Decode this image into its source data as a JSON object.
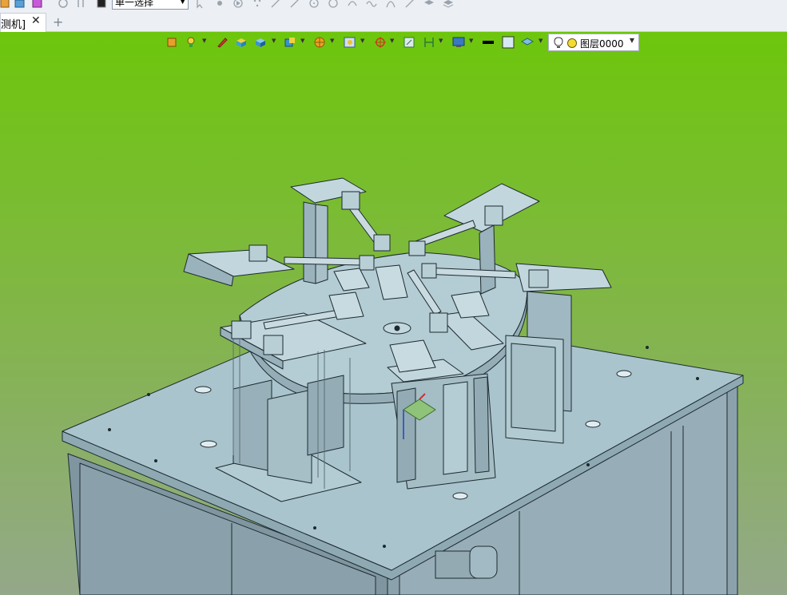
{
  "toolbar": {
    "select_mode": "单一选择"
  },
  "tabs": {
    "document_tab_label": "测机]",
    "close_symbol": "✕",
    "add_symbol": "+"
  },
  "view_toolbar": {
    "layer_name": "图层0000"
  },
  "colors": {
    "viewport_top": "#6dc60c",
    "viewport_bottom": "#94a88a",
    "model_surface": "#a7c3cc",
    "model_edge": "#1c2a30",
    "toolbar_bg": "#eceff3"
  },
  "icons": [
    "new-file-icon",
    "open-file-icon",
    "save-file-icon",
    "undo-icon",
    "redo-icon",
    "cursor-select-icon",
    "point-icon",
    "line-icon",
    "arc-icon",
    "circle-icon",
    "spline-icon",
    "view-orient-icon",
    "light-bulb-icon",
    "visibility-icon",
    "layer-color-icon"
  ]
}
